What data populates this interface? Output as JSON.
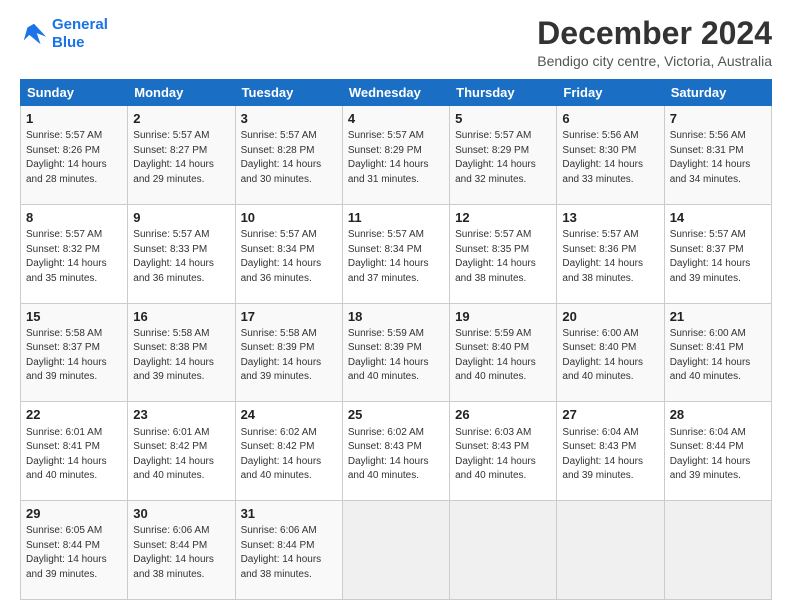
{
  "logo": {
    "line1": "General",
    "line2": "Blue"
  },
  "title": "December 2024",
  "subtitle": "Bendigo city centre, Victoria, Australia",
  "days_of_week": [
    "Sunday",
    "Monday",
    "Tuesday",
    "Wednesday",
    "Thursday",
    "Friday",
    "Saturday"
  ],
  "weeks": [
    [
      {
        "day": 1,
        "sunrise": "5:57 AM",
        "sunset": "8:26 PM",
        "daylight": "14 hours and 28 minutes."
      },
      {
        "day": 2,
        "sunrise": "5:57 AM",
        "sunset": "8:27 PM",
        "daylight": "14 hours and 29 minutes."
      },
      {
        "day": 3,
        "sunrise": "5:57 AM",
        "sunset": "8:28 PM",
        "daylight": "14 hours and 30 minutes."
      },
      {
        "day": 4,
        "sunrise": "5:57 AM",
        "sunset": "8:29 PM",
        "daylight": "14 hours and 31 minutes."
      },
      {
        "day": 5,
        "sunrise": "5:57 AM",
        "sunset": "8:29 PM",
        "daylight": "14 hours and 32 minutes."
      },
      {
        "day": 6,
        "sunrise": "5:56 AM",
        "sunset": "8:30 PM",
        "daylight": "14 hours and 33 minutes."
      },
      {
        "day": 7,
        "sunrise": "5:56 AM",
        "sunset": "8:31 PM",
        "daylight": "14 hours and 34 minutes."
      }
    ],
    [
      {
        "day": 8,
        "sunrise": "5:57 AM",
        "sunset": "8:32 PM",
        "daylight": "14 hours and 35 minutes."
      },
      {
        "day": 9,
        "sunrise": "5:57 AM",
        "sunset": "8:33 PM",
        "daylight": "14 hours and 36 minutes."
      },
      {
        "day": 10,
        "sunrise": "5:57 AM",
        "sunset": "8:34 PM",
        "daylight": "14 hours and 36 minutes."
      },
      {
        "day": 11,
        "sunrise": "5:57 AM",
        "sunset": "8:34 PM",
        "daylight": "14 hours and 37 minutes."
      },
      {
        "day": 12,
        "sunrise": "5:57 AM",
        "sunset": "8:35 PM",
        "daylight": "14 hours and 38 minutes."
      },
      {
        "day": 13,
        "sunrise": "5:57 AM",
        "sunset": "8:36 PM",
        "daylight": "14 hours and 38 minutes."
      },
      {
        "day": 14,
        "sunrise": "5:57 AM",
        "sunset": "8:37 PM",
        "daylight": "14 hours and 39 minutes."
      }
    ],
    [
      {
        "day": 15,
        "sunrise": "5:58 AM",
        "sunset": "8:37 PM",
        "daylight": "14 hours and 39 minutes."
      },
      {
        "day": 16,
        "sunrise": "5:58 AM",
        "sunset": "8:38 PM",
        "daylight": "14 hours and 39 minutes."
      },
      {
        "day": 17,
        "sunrise": "5:58 AM",
        "sunset": "8:39 PM",
        "daylight": "14 hours and 39 minutes."
      },
      {
        "day": 18,
        "sunrise": "5:59 AM",
        "sunset": "8:39 PM",
        "daylight": "14 hours and 40 minutes."
      },
      {
        "day": 19,
        "sunrise": "5:59 AM",
        "sunset": "8:40 PM",
        "daylight": "14 hours and 40 minutes."
      },
      {
        "day": 20,
        "sunrise": "6:00 AM",
        "sunset": "8:40 PM",
        "daylight": "14 hours and 40 minutes."
      },
      {
        "day": 21,
        "sunrise": "6:00 AM",
        "sunset": "8:41 PM",
        "daylight": "14 hours and 40 minutes."
      }
    ],
    [
      {
        "day": 22,
        "sunrise": "6:01 AM",
        "sunset": "8:41 PM",
        "daylight": "14 hours and 40 minutes."
      },
      {
        "day": 23,
        "sunrise": "6:01 AM",
        "sunset": "8:42 PM",
        "daylight": "14 hours and 40 minutes."
      },
      {
        "day": 24,
        "sunrise": "6:02 AM",
        "sunset": "8:42 PM",
        "daylight": "14 hours and 40 minutes."
      },
      {
        "day": 25,
        "sunrise": "6:02 AM",
        "sunset": "8:43 PM",
        "daylight": "14 hours and 40 minutes."
      },
      {
        "day": 26,
        "sunrise": "6:03 AM",
        "sunset": "8:43 PM",
        "daylight": "14 hours and 40 minutes."
      },
      {
        "day": 27,
        "sunrise": "6:04 AM",
        "sunset": "8:43 PM",
        "daylight": "14 hours and 39 minutes."
      },
      {
        "day": 28,
        "sunrise": "6:04 AM",
        "sunset": "8:44 PM",
        "daylight": "14 hours and 39 minutes."
      }
    ],
    [
      {
        "day": 29,
        "sunrise": "6:05 AM",
        "sunset": "8:44 PM",
        "daylight": "14 hours and 39 minutes."
      },
      {
        "day": 30,
        "sunrise": "6:06 AM",
        "sunset": "8:44 PM",
        "daylight": "14 hours and 38 minutes."
      },
      {
        "day": 31,
        "sunrise": "6:06 AM",
        "sunset": "8:44 PM",
        "daylight": "14 hours and 38 minutes."
      },
      null,
      null,
      null,
      null
    ]
  ]
}
